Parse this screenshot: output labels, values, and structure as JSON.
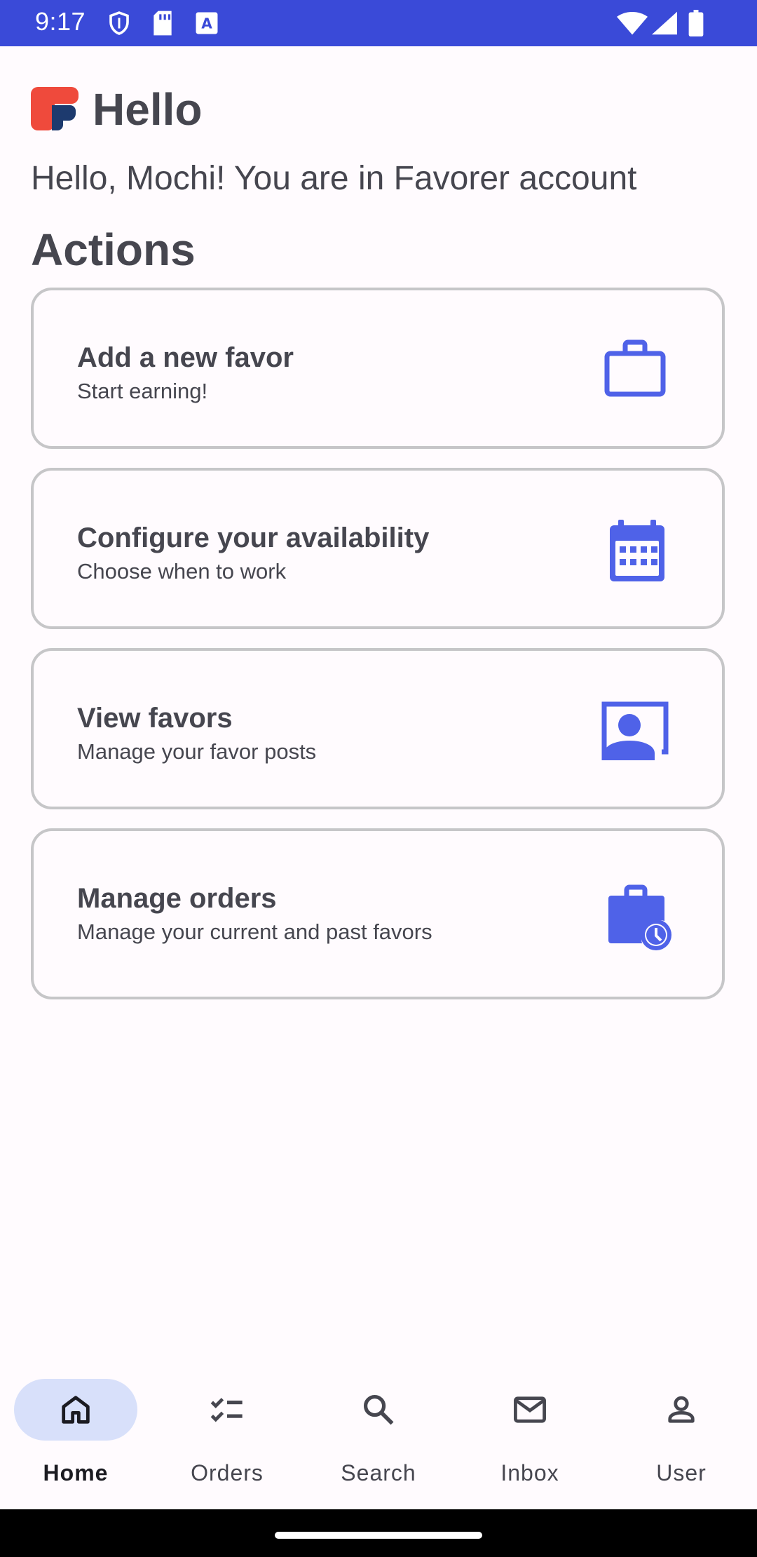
{
  "status_bar": {
    "time": "9:17",
    "bg_color": "#3a4ad8",
    "icons": [
      "shield-icon",
      "sd-card-icon",
      "keyboard-a-icon",
      "wifi-icon",
      "signal-icon",
      "battery-icon"
    ]
  },
  "header": {
    "title": "Hello",
    "greeting": "Hello, Mochi! You are in Favorer account"
  },
  "actions": {
    "section_title": "Actions",
    "items": [
      {
        "title": "Add a new favor",
        "subtitle": "Start earning!",
        "icon": "briefcase-icon"
      },
      {
        "title": "Configure your availability",
        "subtitle": "Choose when to work",
        "icon": "calendar-icon"
      },
      {
        "title": "View favors",
        "subtitle": "Manage your favor posts",
        "icon": "account-box-icon"
      },
      {
        "title": "Manage orders",
        "subtitle": "Manage your current and past favors",
        "icon": "work-history-icon"
      }
    ]
  },
  "bottom_nav": {
    "active": "Home",
    "items": [
      {
        "label": "Home",
        "icon": "home-icon"
      },
      {
        "label": "Orders",
        "icon": "checklist-icon"
      },
      {
        "label": "Search",
        "icon": "search-icon"
      },
      {
        "label": "Inbox",
        "icon": "mail-icon"
      },
      {
        "label": "User",
        "icon": "person-icon"
      }
    ]
  },
  "colors": {
    "accent": "#4f62e8",
    "nav_pill": "#d8e0fa",
    "logo_red": "#ef4a3c",
    "logo_navy": "#1d3a6e"
  }
}
